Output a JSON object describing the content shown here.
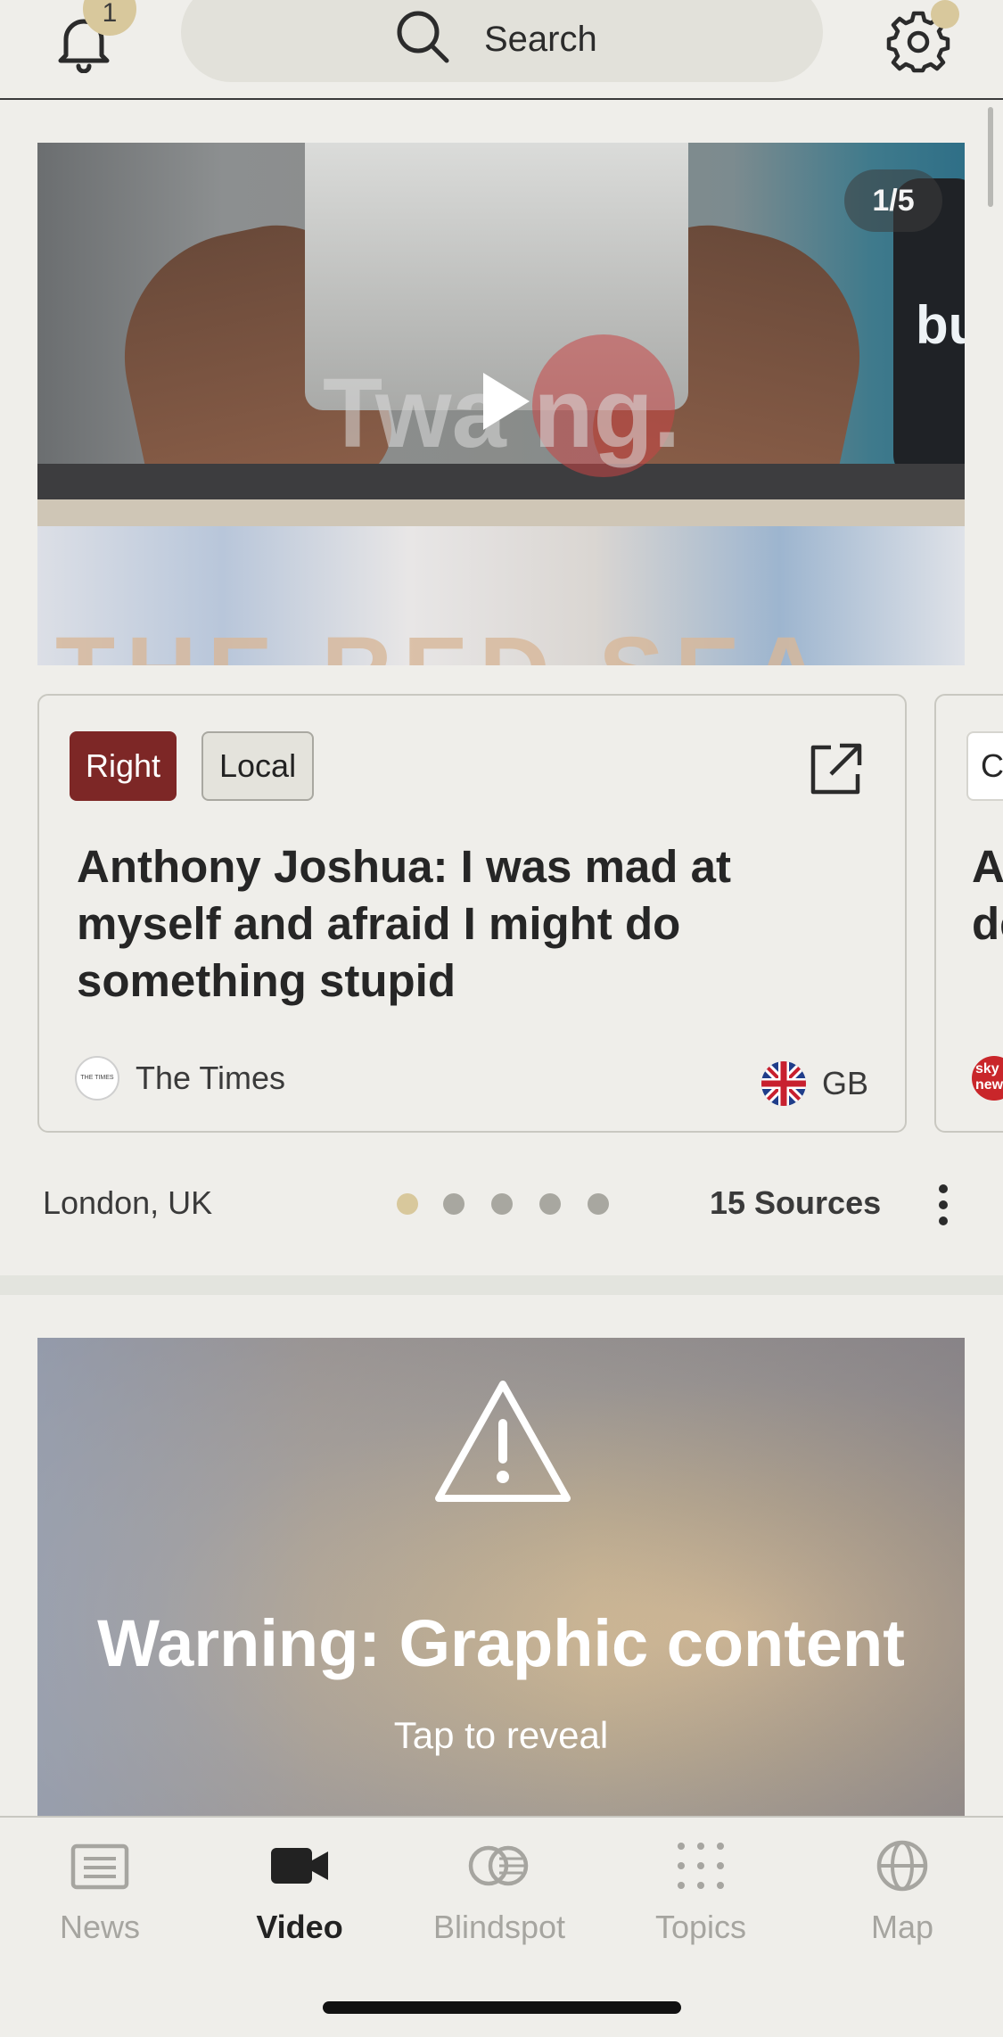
{
  "topbar": {
    "notification_count": "1",
    "search_label": "Search"
  },
  "video": {
    "counter": "1/5",
    "watermark": "Twa ng.",
    "banner_text": "THE RED SEA",
    "bottle_text": "bu"
  },
  "story": {
    "tags": [
      "Right",
      "Local"
    ],
    "tag_colors": {
      "right": "#7d2726",
      "local": "#e4e3dc"
    },
    "headline": "Anthony Joshua: I was mad at myself and afraid I might do something stupid",
    "source": "The Times",
    "source_logo": "THE TIMES",
    "country": "GB",
    "location": "London, UK",
    "sources_count": "15 Sources",
    "carousel_dots": 5,
    "active_dot": 1
  },
  "peek_card": {
    "tag": "C",
    "headline": "A\nde",
    "logo": "sky news"
  },
  "warning": {
    "title": "Warning: Graphic content",
    "subtitle": "Tap to reveal"
  },
  "bottom_nav": {
    "items": [
      {
        "label": "News",
        "icon": "newspaper-icon",
        "active": false
      },
      {
        "label": "Video",
        "icon": "video-camera-icon",
        "active": true
      },
      {
        "label": "Blindspot",
        "icon": "blindspot-icon",
        "active": false
      },
      {
        "label": "Topics",
        "icon": "grid-dots-icon",
        "active": false
      },
      {
        "label": "Map",
        "icon": "globe-icon",
        "active": false
      }
    ]
  },
  "colors": {
    "accent": "#d8c89c",
    "background": "#efeeea",
    "right_tag": "#7d2726"
  }
}
